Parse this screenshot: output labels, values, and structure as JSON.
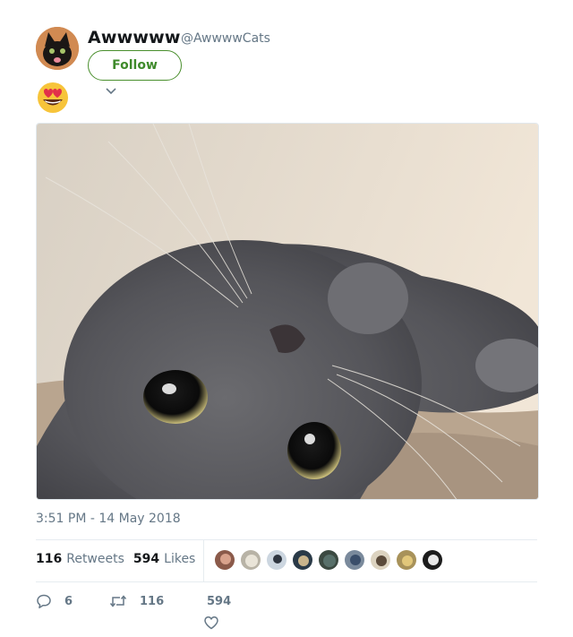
{
  "tweet": {
    "author_name": "Awwwww",
    "author_handle": "@AwwwwCats",
    "follow_label": "Follow",
    "emoji": "😍",
    "timestamp": "3:51 PM - 14 May 2018",
    "retweets_count": "116",
    "retweets_label": "Retweets",
    "likes_count": "594",
    "likes_label": "Likes",
    "reply_count": "6",
    "retweet_action_count": "116",
    "like_action_count": "594"
  },
  "colors": {
    "follow_green": "#3e8a2a",
    "muted_text": "#657786",
    "divider": "#e6ecf0"
  }
}
